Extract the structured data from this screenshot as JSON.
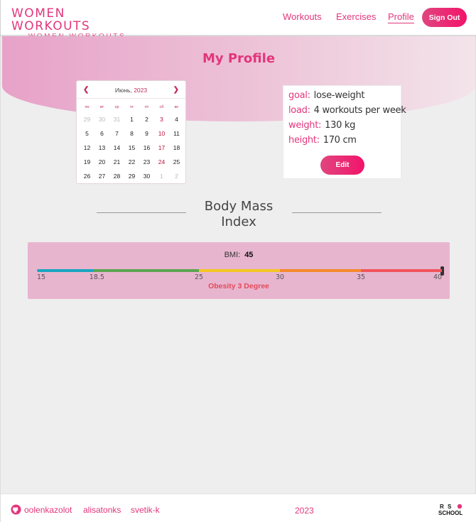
{
  "header": {
    "logo_main": "WOMEN WORKOUTS",
    "logo_sub": "WOMEN WORKOUTS",
    "nav": [
      {
        "label": "Workouts",
        "active": false
      },
      {
        "label": "Exercises",
        "active": false
      },
      {
        "label": "Profile",
        "active": true
      }
    ],
    "sign_out_label": "Sign Out"
  },
  "page_title": "My Profile",
  "calendar": {
    "month_label": "Июнь,",
    "year_label": "2023",
    "weekdays": [
      "пн",
      "вт",
      "ср",
      "чт",
      "пт",
      "сб",
      "вс"
    ],
    "weeks": [
      [
        "29",
        "30",
        "31",
        "1",
        "2",
        "3",
        "4"
      ],
      [
        "5",
        "6",
        "7",
        "8",
        "9",
        "10",
        "11"
      ],
      [
        "12",
        "13",
        "14",
        "15",
        "16",
        "17",
        "18"
      ],
      [
        "19",
        "20",
        "21",
        "22",
        "23",
        "24",
        "25"
      ],
      [
        "26",
        "27",
        "28",
        "29",
        "30",
        "1",
        "2"
      ]
    ]
  },
  "profile": {
    "goal_label": "goal:",
    "goal_value": "lose-weight",
    "load_label": "load:",
    "load_value": "4 workouts per week",
    "weight_label": "weight:",
    "weight_value": "130 kg",
    "height_label": "height:",
    "height_value": "170 cm",
    "edit_label": "Edit"
  },
  "bmi": {
    "title_line1": "Body Mass",
    "title_line2": "Index",
    "label": "BMI:",
    "value": "45",
    "scale_min": 15,
    "scale_max": 40,
    "ticks": [
      "15",
      "18.5",
      "25",
      "30",
      "35",
      "40"
    ],
    "segments": [
      {
        "from": 15,
        "to": 18.5,
        "color": "#1aa5c2"
      },
      {
        "from": 18.5,
        "to": 25,
        "color": "#5ba552"
      },
      {
        "from": 25,
        "to": 30,
        "color": "#f3c623"
      },
      {
        "from": 30,
        "to": 35,
        "color": "#f58a2b"
      },
      {
        "from": 35,
        "to": 40,
        "color": "#f2545b"
      }
    ],
    "category": "Obesity 3 Degree"
  },
  "footer": {
    "authors": [
      "oolenkazolot",
      "alisatonks",
      "svetik-k"
    ],
    "year": "2023",
    "school_logo": "RS SCHOOL"
  },
  "colors": {
    "accent": "#e2367c",
    "button_gradient_start": "#e0457f",
    "button_gradient_end": "#f2146a",
    "bmi_panel": "#e8b5cf"
  }
}
